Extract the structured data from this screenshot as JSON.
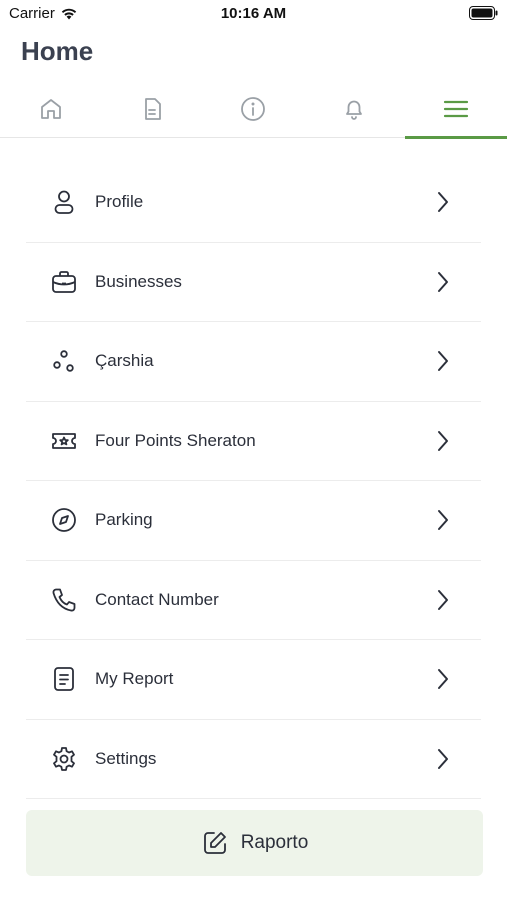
{
  "status_bar": {
    "carrier": "Carrier",
    "time": "10:16 AM"
  },
  "header": {
    "title": "Home"
  },
  "tabs": [
    {
      "icon": "home-icon",
      "active": false
    },
    {
      "icon": "document-icon",
      "active": false
    },
    {
      "icon": "info-icon",
      "active": false
    },
    {
      "icon": "bell-icon",
      "active": false
    },
    {
      "icon": "menu-icon",
      "active": true
    }
  ],
  "menu": {
    "items": [
      {
        "label": "Profile",
        "icon": "user-icon"
      },
      {
        "label": "Businesses",
        "icon": "briefcase-icon"
      },
      {
        "label": "Çarshia",
        "icon": "dots-icon"
      },
      {
        "label": "Four Points Sheraton",
        "icon": "ticket-star-icon"
      },
      {
        "label": "Parking",
        "icon": "compass-icon"
      },
      {
        "label": "Contact Number",
        "icon": "phone-icon"
      },
      {
        "label": "My Report",
        "icon": "report-icon"
      },
      {
        "label": "Settings",
        "icon": "gear-icon"
      }
    ]
  },
  "report_button": {
    "label": "Raporto",
    "icon": "edit-icon"
  },
  "colors": {
    "accent": "#5a9a45",
    "icon_gray": "#9aa0a6",
    "text": "#2b2f3a",
    "button_bg": "#eef4ea"
  }
}
